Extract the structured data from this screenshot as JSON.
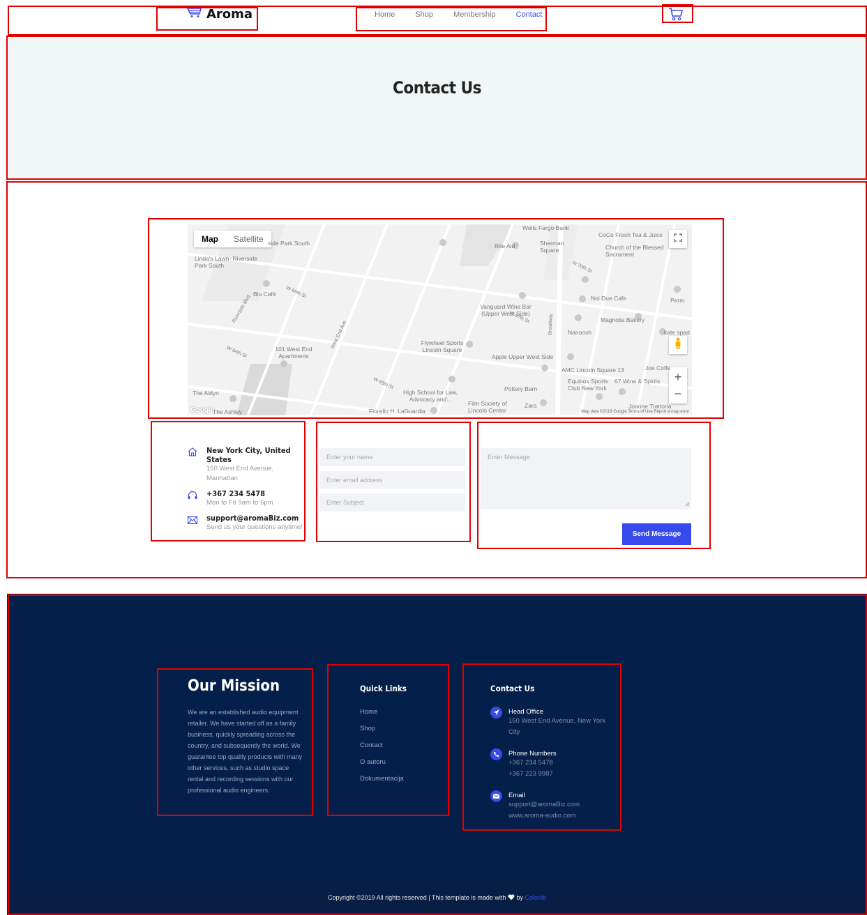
{
  "header": {
    "brand": "Aroma",
    "nav": [
      {
        "label": "Home"
      },
      {
        "label": "Shop"
      },
      {
        "label": "Membership"
      },
      {
        "label": "Contact"
      }
    ],
    "active_nav": "Contact",
    "accent_color": "#384aeb"
  },
  "hero": {
    "title": "Contact Us"
  },
  "map": {
    "toggle_map": "Map",
    "toggle_satellite": "Satellite",
    "labels": {
      "wells_fargo": "Wells Fargo Bank",
      "coco": "CoCo Fresh Tea & Juice",
      "rite_aid": "Rite Aid",
      "sherman": "Sherman Square",
      "church": "Church of the Blessed Sacrament",
      "riverside_south": "side Park South",
      "lindas": "Linda's Lawn- Riverside Park South",
      "blu": "Blu Café",
      "vanguard": "Vanguard Wine Bar (Upper West Side)",
      "noi_due": "Noi Due Cafe",
      "perm": "Perm",
      "magnolia": "Magnolia Bakery",
      "nanoosh": "Nanoosh",
      "kate": "kate spad",
      "wend": "101 West End Apartments",
      "flywheel": "Flywheel Sports Lincoln Square",
      "apple": "Apple Upper West Side",
      "amc": "AMC Lincoln Square 13",
      "joe": "Joe Coffe",
      "equinox": "Equinox Sports Club New York",
      "wine67": "67 Wine & Spirits",
      "aldyn": "The Aldyn",
      "highschool": "High School for Law, Advocacy and...",
      "pottery": "Pottery Barn",
      "film": "Film Society of Lincoln Center",
      "zara": "Zara",
      "ashley": "The Ashley",
      "fiorello": "Fiorello H. LaGuardia",
      "joanne": "Joanne Trattoria",
      "st_w66": "W 66th St",
      "st_w64": "W 64th St",
      "st_w65": "W 65th St",
      "st_w67": "W 67th St",
      "st_w70": "W 70th St",
      "broadway": "Broadway",
      "west_end": "West End Ave",
      "riverside_blvd": "Riverside Blvd"
    },
    "attribution": "Map data ©2019 Google   Terms of Use   Report a map error",
    "google": "Google"
  },
  "contact_info": [
    {
      "title": "New York City, United States",
      "sub": "150 West End Avenue, Manhattan",
      "icon": "home-icon"
    },
    {
      "title": "+367 234 5478",
      "sub": "Mon to Fri 9am to 6pm",
      "icon": "headphones-icon"
    },
    {
      "title": "support@aromaBiz.com",
      "sub": "Send us your questions anytime!",
      "icon": "envelope-icon"
    }
  ],
  "form": {
    "name_placeholder": "Enter your name",
    "email_placeholder": "Enter email address",
    "subject_placeholder": "Enter Subject",
    "message_placeholder": "Enter Message",
    "submit": "Send Message"
  },
  "footer": {
    "mission_title": "Our Mission",
    "mission_text": "We are an established audio equipment retailer. We have started off as a family business, quickly spreading across the country, and subsequently the world. We guarantee top quality products with many other services, such as studio space rental and recording sessions with our professional audio engineers.",
    "quick_links_title": "Quick Links",
    "quick_links": [
      {
        "label": "Home"
      },
      {
        "label": "Shop"
      },
      {
        "label": "Contact"
      },
      {
        "label": "O autoru"
      },
      {
        "label": "Dokumentacija"
      }
    ],
    "contact_title": "Contact Us",
    "contact": [
      {
        "head": "Head Office",
        "lines": [
          "150 West End Avenue, New York City"
        ],
        "icon": "location-arrow-icon"
      },
      {
        "head": "Phone Numbers",
        "lines": [
          "+367 234 5478",
          "+367 223 9987"
        ],
        "icon": "phone-icon"
      },
      {
        "head": "Email",
        "lines": [
          "support@aromaBiz.com",
          "www.aroma-audio.com"
        ],
        "icon": "envelope-icon"
      }
    ],
    "copyright": "Copyright ©2019 All rights reserved | This template is made with",
    "by": "by",
    "colorlib": "Colorlib"
  }
}
